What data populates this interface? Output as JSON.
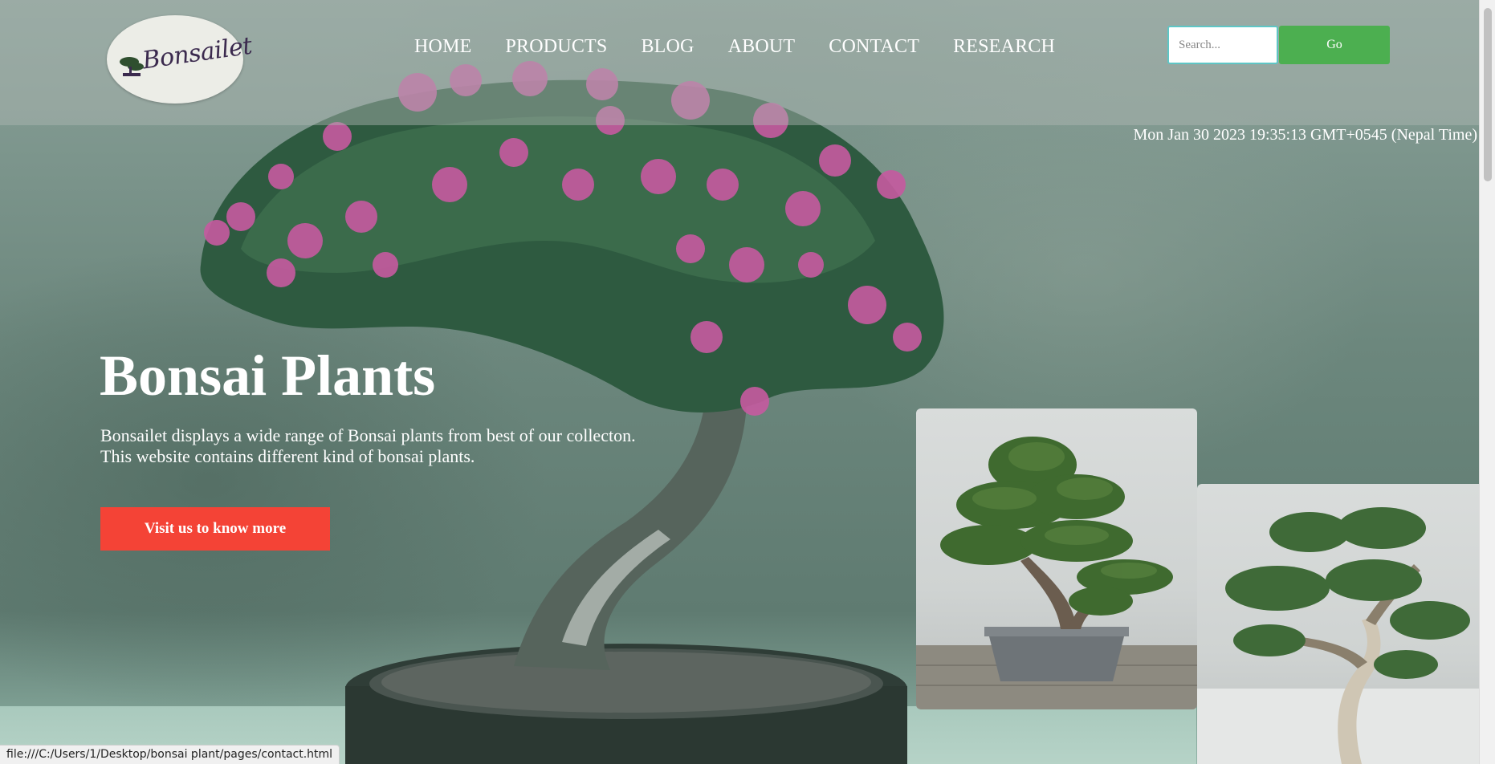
{
  "logo": {
    "text": "Bonsailet"
  },
  "nav": {
    "items": [
      {
        "label": "HOME"
      },
      {
        "label": "PRODUCTS"
      },
      {
        "label": "BLOG"
      },
      {
        "label": "ABOUT"
      },
      {
        "label": "CONTACT"
      },
      {
        "label": "RESEARCH"
      }
    ]
  },
  "search": {
    "placeholder": "Search...",
    "button_label": "Go"
  },
  "datetime": "Mon Jan 30 2023 19:35:13 GMT+0545 (Nepal Time)",
  "hero": {
    "title": "Bonsai Plants",
    "description_lines": [
      "Bonsailet displays a wide range of Bonsai plants from best of our collecton.",
      "This website contains different kind of bonsai plants."
    ],
    "cta_label": "Visit us to know more"
  },
  "status_bar": {
    "url": "file:///C:/Users/1/Desktop/bonsai plant/pages/contact.html"
  },
  "colors": {
    "go_button": "#4caf50",
    "cta_button": "#f44336",
    "search_border": "#5ec6c6",
    "text": "#ffffff"
  }
}
